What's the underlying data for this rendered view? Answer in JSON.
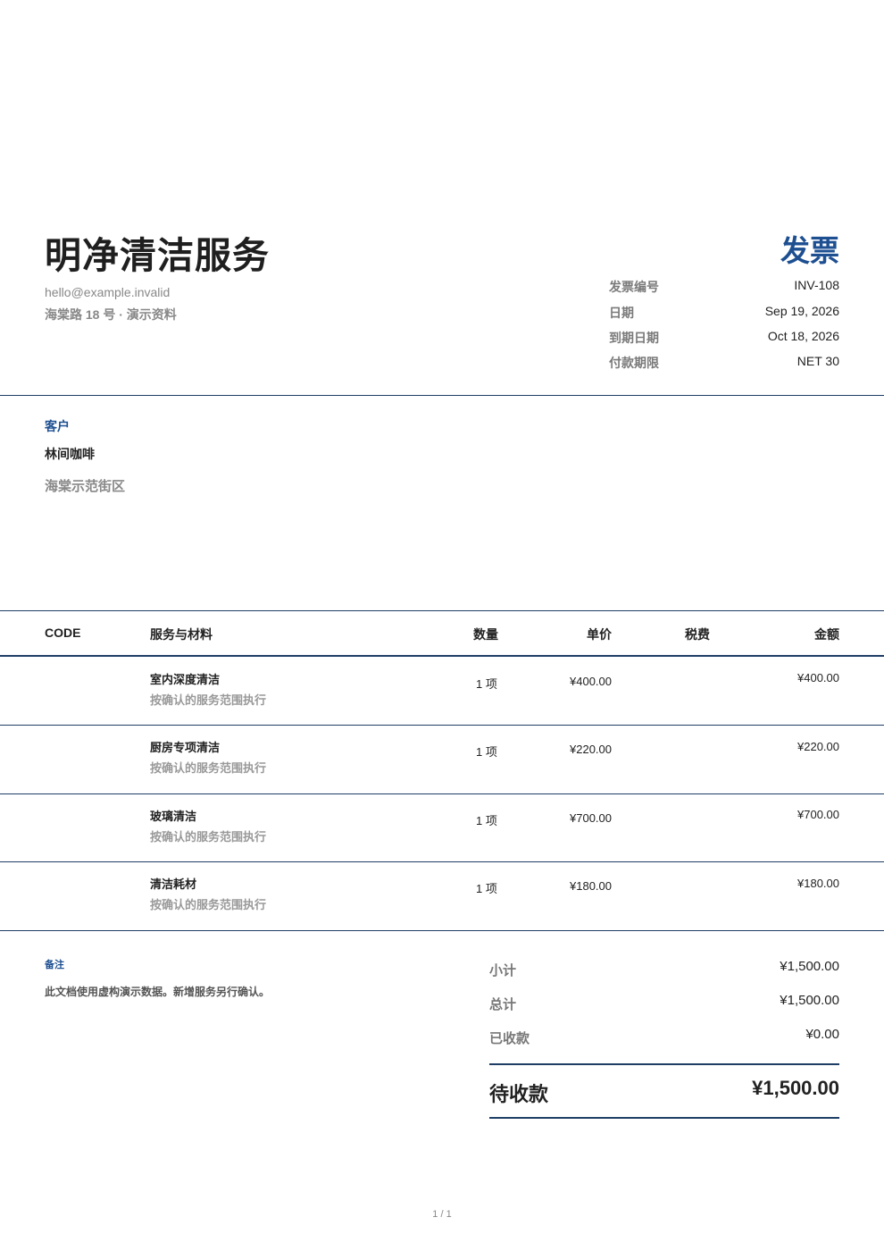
{
  "company": {
    "name": "明净清洁服务",
    "email": "hello@example.invalid",
    "address": "海棠路 18 号 · 演示资料"
  },
  "document": {
    "title": "发票",
    "meta": [
      {
        "label": "发票编号",
        "value": "INV-108"
      },
      {
        "label": "日期",
        "value": "Sep 19, 2026"
      },
      {
        "label": "到期日期",
        "value": "Oct 18, 2026"
      },
      {
        "label": "付款期限",
        "value": "NET 30"
      }
    ]
  },
  "client": {
    "label": "客户",
    "name": "林间咖啡",
    "address": "海棠示范街区"
  },
  "table": {
    "headers": {
      "code": "CODE",
      "description": "服务与材料",
      "quantity": "数量",
      "unit_price": "单价",
      "tax": "税费",
      "amount": "金额"
    },
    "rows": [
      {
        "code": "",
        "description": "室内深度清洁",
        "note": "按确认的服务范围执行",
        "quantity": "1 项",
        "unit_price": "¥400.00",
        "tax": "",
        "amount": "¥400.00"
      },
      {
        "code": "",
        "description": "厨房专项清洁",
        "note": "按确认的服务范围执行",
        "quantity": "1 项",
        "unit_price": "¥220.00",
        "tax": "",
        "amount": "¥220.00"
      },
      {
        "code": "",
        "description": "玻璃清洁",
        "note": "按确认的服务范围执行",
        "quantity": "1 项",
        "unit_price": "¥700.00",
        "tax": "",
        "amount": "¥700.00"
      },
      {
        "code": "",
        "description": "清洁耗材",
        "note": "按确认的服务范围执行",
        "quantity": "1 项",
        "unit_price": "¥180.00",
        "tax": "",
        "amount": "¥180.00"
      }
    ]
  },
  "notes": {
    "label": "备注",
    "text": "此文档使用虚构演示数据。新增服务另行确认。"
  },
  "totals": {
    "subtotal_label": "小计",
    "subtotal": "¥1,500.00",
    "total_label": "总计",
    "total": "¥1,500.00",
    "paid_label": "已收款",
    "paid": "¥0.00",
    "due_label": "待收款",
    "due": "¥1,500.00"
  },
  "footer": {
    "page": "1 / 1"
  },
  "colors": {
    "accent": "#1d4f91",
    "rule": "#1f3e66"
  }
}
